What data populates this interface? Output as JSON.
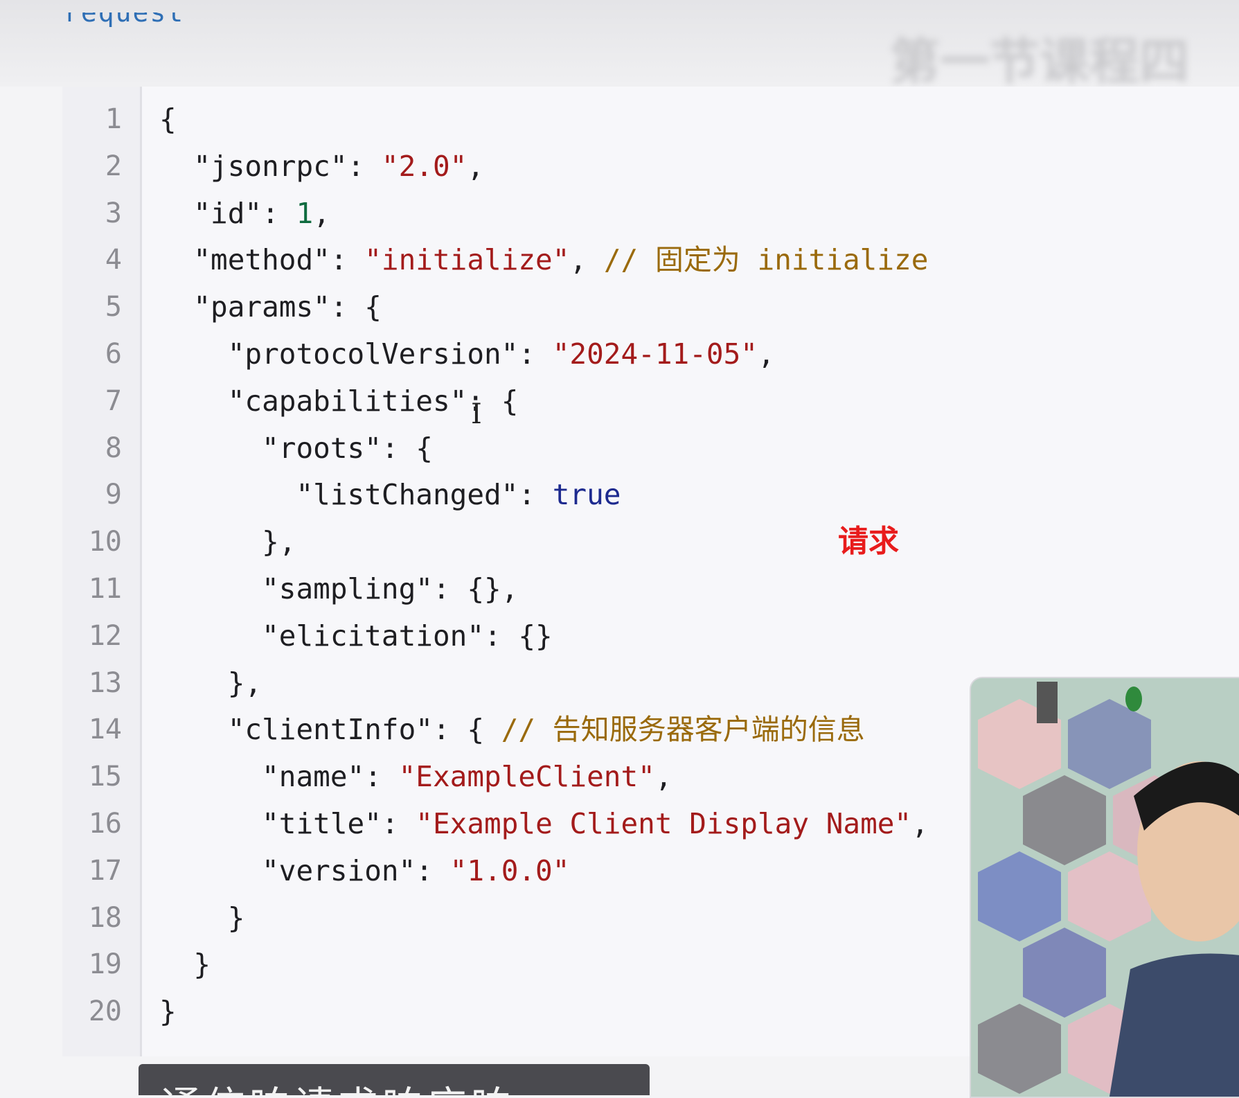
{
  "header": {
    "title": "request",
    "blurred_title": "第一节课程四"
  },
  "code": {
    "lines": [
      {
        "num": "1",
        "tokens": [
          {
            "t": "{",
            "c": "punc"
          }
        ]
      },
      {
        "num": "2",
        "tokens": [
          {
            "t": "  \"jsonrpc\"",
            "c": "key"
          },
          {
            "t": ": ",
            "c": "punc"
          },
          {
            "t": "\"2.0\"",
            "c": "str"
          },
          {
            "t": ",",
            "c": "punc"
          }
        ]
      },
      {
        "num": "3",
        "tokens": [
          {
            "t": "  \"id\"",
            "c": "key"
          },
          {
            "t": ": ",
            "c": "punc"
          },
          {
            "t": "1",
            "c": "num"
          },
          {
            "t": ",",
            "c": "punc"
          }
        ]
      },
      {
        "num": "4",
        "tokens": [
          {
            "t": "  \"method\"",
            "c": "key"
          },
          {
            "t": ": ",
            "c": "punc"
          },
          {
            "t": "\"initialize\"",
            "c": "str"
          },
          {
            "t": ", ",
            "c": "punc"
          },
          {
            "t": "// 固定为 initialize",
            "c": "cmt"
          }
        ]
      },
      {
        "num": "5",
        "tokens": [
          {
            "t": "  \"params\"",
            "c": "key"
          },
          {
            "t": ": {",
            "c": "punc"
          }
        ]
      },
      {
        "num": "6",
        "tokens": [
          {
            "t": "    \"protocolVersion\"",
            "c": "key"
          },
          {
            "t": ": ",
            "c": "punc"
          },
          {
            "t": "\"2024-11-05\"",
            "c": "str"
          },
          {
            "t": ",",
            "c": "punc"
          }
        ]
      },
      {
        "num": "7",
        "tokens": [
          {
            "t": "    \"capabilities\"",
            "c": "key"
          },
          {
            "t": ": {",
            "c": "punc"
          }
        ]
      },
      {
        "num": "8",
        "tokens": [
          {
            "t": "      \"roots\"",
            "c": "key"
          },
          {
            "t": ": {",
            "c": "punc"
          }
        ]
      },
      {
        "num": "9",
        "tokens": [
          {
            "t": "        \"listChanged\"",
            "c": "key"
          },
          {
            "t": ": ",
            "c": "punc"
          },
          {
            "t": "true",
            "c": "bool"
          }
        ]
      },
      {
        "num": "10",
        "tokens": [
          {
            "t": "      },",
            "c": "punc"
          }
        ]
      },
      {
        "num": "11",
        "tokens": [
          {
            "t": "      \"sampling\"",
            "c": "key"
          },
          {
            "t": ": {},",
            "c": "punc"
          }
        ]
      },
      {
        "num": "12",
        "tokens": [
          {
            "t": "      \"elicitation\"",
            "c": "key"
          },
          {
            "t": ": {}",
            "c": "punc"
          }
        ]
      },
      {
        "num": "13",
        "tokens": [
          {
            "t": "    },",
            "c": "punc"
          }
        ]
      },
      {
        "num": "14",
        "tokens": [
          {
            "t": "    \"clientInfo\"",
            "c": "key"
          },
          {
            "t": ": { ",
            "c": "punc"
          },
          {
            "t": "// 告知服务器客户端的信息",
            "c": "cmt"
          }
        ]
      },
      {
        "num": "15",
        "tokens": [
          {
            "t": "      \"name\"",
            "c": "key"
          },
          {
            "t": ": ",
            "c": "punc"
          },
          {
            "t": "\"ExampleClient\"",
            "c": "str"
          },
          {
            "t": ",",
            "c": "punc"
          }
        ]
      },
      {
        "num": "16",
        "tokens": [
          {
            "t": "      \"title\"",
            "c": "key"
          },
          {
            "t": ": ",
            "c": "punc"
          },
          {
            "t": "\"Example Client Display Name\"",
            "c": "str"
          },
          {
            "t": ",",
            "c": "punc"
          }
        ]
      },
      {
        "num": "17",
        "tokens": [
          {
            "t": "      \"version\"",
            "c": "key"
          },
          {
            "t": ": ",
            "c": "punc"
          },
          {
            "t": "\"1.0.0\"",
            "c": "str"
          }
        ]
      },
      {
        "num": "18",
        "tokens": [
          {
            "t": "    }",
            "c": "punc"
          }
        ]
      },
      {
        "num": "19",
        "tokens": [
          {
            "t": "  }",
            "c": "punc"
          }
        ]
      },
      {
        "num": "20",
        "tokens": [
          {
            "t": "}",
            "c": "punc"
          }
        ]
      }
    ]
  },
  "annotation": {
    "label": "请求",
    "color": "#e81c1c"
  },
  "cursor_glyph": "I",
  "subtitle": {
    "text": "通信响请求响应响"
  },
  "webcam": {
    "icon": "presenter-video-icon"
  }
}
